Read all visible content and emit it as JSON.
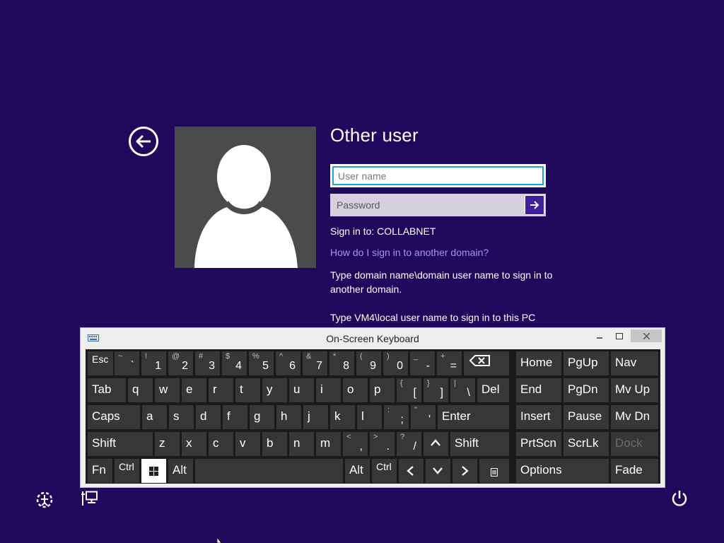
{
  "login": {
    "title": "Other user",
    "username_placeholder": "User name",
    "password_placeholder": "Password",
    "sign_in_to": "Sign in to: COLLABNET",
    "help_link": "How do I sign in to another domain?",
    "help_text_1": "Type domain name\\domain user name to sign in to another domain.",
    "help_text_2": "Type VM4\\local user name to sign in to this PC"
  },
  "keyboard": {
    "title": "On-Screen Keyboard",
    "row1": [
      {
        "main": "Esc"
      },
      {
        "top": "~",
        "main": "`"
      },
      {
        "top": "!",
        "main": "1"
      },
      {
        "top": "@",
        "main": "2"
      },
      {
        "top": "#",
        "main": "3"
      },
      {
        "top": "$",
        "main": "4"
      },
      {
        "top": "%",
        "main": "5"
      },
      {
        "top": "^",
        "main": "6"
      },
      {
        "top": "&",
        "main": "7"
      },
      {
        "top": "*",
        "main": "8"
      },
      {
        "top": "(",
        "main": "9"
      },
      {
        "top": ")",
        "main": "0"
      },
      {
        "top": "_",
        "main": "-"
      },
      {
        "top": "+",
        "main": "="
      }
    ],
    "row2": [
      {
        "main": "Tab"
      },
      {
        "main": "q"
      },
      {
        "main": "w"
      },
      {
        "main": "e"
      },
      {
        "main": "r"
      },
      {
        "main": "t"
      },
      {
        "main": "y"
      },
      {
        "main": "u"
      },
      {
        "main": "i"
      },
      {
        "main": "o"
      },
      {
        "main": "p"
      },
      {
        "top": "{",
        "main": "["
      },
      {
        "top": "}",
        "main": "]"
      },
      {
        "top": "|",
        "main": "\\"
      },
      {
        "main": "Del"
      }
    ],
    "row3": [
      {
        "main": "Caps"
      },
      {
        "main": "a"
      },
      {
        "main": "s"
      },
      {
        "main": "d"
      },
      {
        "main": "f"
      },
      {
        "main": "g"
      },
      {
        "main": "h"
      },
      {
        "main": "j"
      },
      {
        "main": "k"
      },
      {
        "main": "l"
      },
      {
        "top": ":",
        "main": ";"
      },
      {
        "top": "\"",
        "main": "'"
      },
      {
        "main": "Enter"
      }
    ],
    "row4": [
      {
        "main": "Shift"
      },
      {
        "main": "z"
      },
      {
        "main": "x"
      },
      {
        "main": "c"
      },
      {
        "main": "v"
      },
      {
        "main": "b"
      },
      {
        "main": "n"
      },
      {
        "main": "m"
      },
      {
        "top": "<",
        "main": ","
      },
      {
        "top": ">",
        "main": "."
      },
      {
        "top": "?",
        "main": "/"
      },
      {
        "main": "Shift"
      }
    ],
    "row5": [
      {
        "main": "Fn"
      },
      {
        "main": "Ctrl"
      },
      {
        "main": "Alt"
      },
      {
        "main": "Alt"
      },
      {
        "main": "Ctrl"
      }
    ],
    "nav": [
      {
        "main": "Home"
      },
      {
        "main": "PgUp"
      },
      {
        "main": "Nav"
      },
      {
        "main": "End"
      },
      {
        "main": "PgDn"
      },
      {
        "main": "Mv Up"
      },
      {
        "main": "Insert"
      },
      {
        "main": "Pause"
      },
      {
        "main": "Mv Dn"
      },
      {
        "main": "PrtScn"
      },
      {
        "main": "ScrLk"
      },
      {
        "main": "Dock"
      },
      {
        "main": "Options"
      },
      {
        "main": "Fade"
      }
    ]
  },
  "icons": {
    "back": "back-arrow-icon",
    "submit": "arrow-right-icon",
    "ease_of_access": "ease-of-access-icon",
    "network": "network-icon",
    "power": "power-icon",
    "backspace": "backspace-icon",
    "windows": "windows-logo-icon"
  },
  "colors": {
    "background": "#20085c",
    "accent": "#3f1fa0",
    "link": "#a894f0",
    "focus_border": "#1ea0d8"
  }
}
